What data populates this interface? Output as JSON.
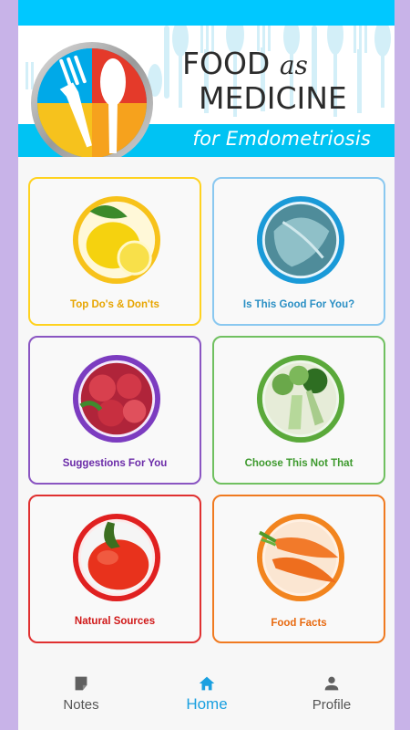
{
  "banner": {
    "title_word1": "FOOD",
    "title_as": "as",
    "title_word2": "MEDICINE",
    "subtitle": "for Emdometriosis"
  },
  "cards": [
    {
      "label": "Top Do's & Don'ts",
      "color": "#ffd21f",
      "text_color": "#e7a500",
      "icon": "lemon-icon"
    },
    {
      "label": "Is This Good For You?",
      "color": "#8ac8f0",
      "text_color": "#2a8fc4",
      "icon": "cabbage-icon"
    },
    {
      "label": "Suggestions For You",
      "color": "#8a55c2",
      "text_color": "#6a2aa8",
      "icon": "raspberries-icon"
    },
    {
      "label": "Choose This Not That",
      "color": "#70c060",
      "text_color": "#3e9a2e",
      "icon": "broccoli-icon"
    },
    {
      "label": "Natural Sources",
      "color": "#e03030",
      "text_color": "#d01818",
      "icon": "pepper-icon"
    },
    {
      "label": "Food Facts",
      "color": "#f07a20",
      "text_color": "#e86a10",
      "icon": "carrots-icon"
    }
  ],
  "nav": {
    "notes": "Notes",
    "home": "Home",
    "profile": "Profile",
    "active_color": "#1aa0e0"
  }
}
